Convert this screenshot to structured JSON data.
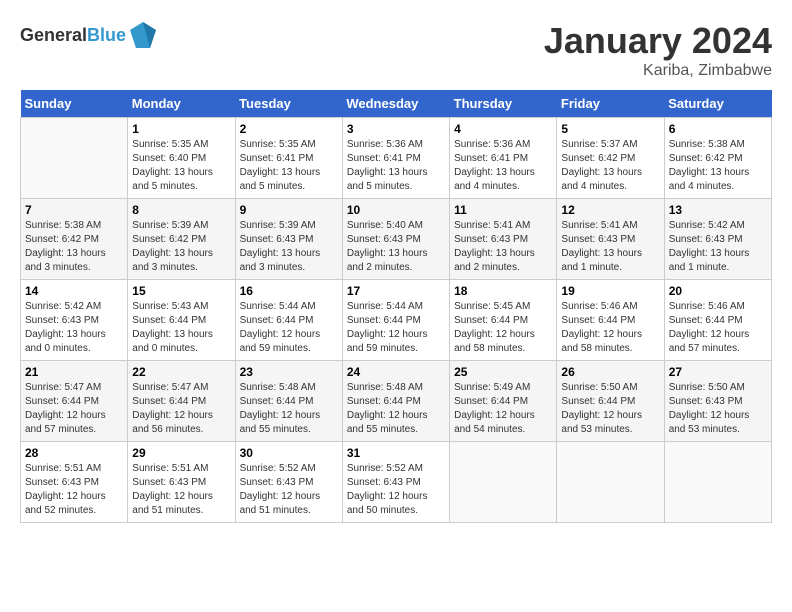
{
  "header": {
    "logo_general": "General",
    "logo_blue": "Blue",
    "month_year": "January 2024",
    "location": "Kariba, Zimbabwe"
  },
  "calendar": {
    "days_of_week": [
      "Sunday",
      "Monday",
      "Tuesday",
      "Wednesday",
      "Thursday",
      "Friday",
      "Saturday"
    ],
    "weeks": [
      [
        {
          "day": "",
          "sunrise": "",
          "sunset": "",
          "daylight": ""
        },
        {
          "day": "1",
          "sunrise": "Sunrise: 5:35 AM",
          "sunset": "Sunset: 6:40 PM",
          "daylight": "Daylight: 13 hours and 5 minutes."
        },
        {
          "day": "2",
          "sunrise": "Sunrise: 5:35 AM",
          "sunset": "Sunset: 6:41 PM",
          "daylight": "Daylight: 13 hours and 5 minutes."
        },
        {
          "day": "3",
          "sunrise": "Sunrise: 5:36 AM",
          "sunset": "Sunset: 6:41 PM",
          "daylight": "Daylight: 13 hours and 5 minutes."
        },
        {
          "day": "4",
          "sunrise": "Sunrise: 5:36 AM",
          "sunset": "Sunset: 6:41 PM",
          "daylight": "Daylight: 13 hours and 4 minutes."
        },
        {
          "day": "5",
          "sunrise": "Sunrise: 5:37 AM",
          "sunset": "Sunset: 6:42 PM",
          "daylight": "Daylight: 13 hours and 4 minutes."
        },
        {
          "day": "6",
          "sunrise": "Sunrise: 5:38 AM",
          "sunset": "Sunset: 6:42 PM",
          "daylight": "Daylight: 13 hours and 4 minutes."
        }
      ],
      [
        {
          "day": "7",
          "sunrise": "Sunrise: 5:38 AM",
          "sunset": "Sunset: 6:42 PM",
          "daylight": "Daylight: 13 hours and 3 minutes."
        },
        {
          "day": "8",
          "sunrise": "Sunrise: 5:39 AM",
          "sunset": "Sunset: 6:42 PM",
          "daylight": "Daylight: 13 hours and 3 minutes."
        },
        {
          "day": "9",
          "sunrise": "Sunrise: 5:39 AM",
          "sunset": "Sunset: 6:43 PM",
          "daylight": "Daylight: 13 hours and 3 minutes."
        },
        {
          "day": "10",
          "sunrise": "Sunrise: 5:40 AM",
          "sunset": "Sunset: 6:43 PM",
          "daylight": "Daylight: 13 hours and 2 minutes."
        },
        {
          "day": "11",
          "sunrise": "Sunrise: 5:41 AM",
          "sunset": "Sunset: 6:43 PM",
          "daylight": "Daylight: 13 hours and 2 minutes."
        },
        {
          "day": "12",
          "sunrise": "Sunrise: 5:41 AM",
          "sunset": "Sunset: 6:43 PM",
          "daylight": "Daylight: 13 hours and 1 minute."
        },
        {
          "day": "13",
          "sunrise": "Sunrise: 5:42 AM",
          "sunset": "Sunset: 6:43 PM",
          "daylight": "Daylight: 13 hours and 1 minute."
        }
      ],
      [
        {
          "day": "14",
          "sunrise": "Sunrise: 5:42 AM",
          "sunset": "Sunset: 6:43 PM",
          "daylight": "Daylight: 13 hours and 0 minutes."
        },
        {
          "day": "15",
          "sunrise": "Sunrise: 5:43 AM",
          "sunset": "Sunset: 6:44 PM",
          "daylight": "Daylight: 13 hours and 0 minutes."
        },
        {
          "day": "16",
          "sunrise": "Sunrise: 5:44 AM",
          "sunset": "Sunset: 6:44 PM",
          "daylight": "Daylight: 12 hours and 59 minutes."
        },
        {
          "day": "17",
          "sunrise": "Sunrise: 5:44 AM",
          "sunset": "Sunset: 6:44 PM",
          "daylight": "Daylight: 12 hours and 59 minutes."
        },
        {
          "day": "18",
          "sunrise": "Sunrise: 5:45 AM",
          "sunset": "Sunset: 6:44 PM",
          "daylight": "Daylight: 12 hours and 58 minutes."
        },
        {
          "day": "19",
          "sunrise": "Sunrise: 5:46 AM",
          "sunset": "Sunset: 6:44 PM",
          "daylight": "Daylight: 12 hours and 58 minutes."
        },
        {
          "day": "20",
          "sunrise": "Sunrise: 5:46 AM",
          "sunset": "Sunset: 6:44 PM",
          "daylight": "Daylight: 12 hours and 57 minutes."
        }
      ],
      [
        {
          "day": "21",
          "sunrise": "Sunrise: 5:47 AM",
          "sunset": "Sunset: 6:44 PM",
          "daylight": "Daylight: 12 hours and 57 minutes."
        },
        {
          "day": "22",
          "sunrise": "Sunrise: 5:47 AM",
          "sunset": "Sunset: 6:44 PM",
          "daylight": "Daylight: 12 hours and 56 minutes."
        },
        {
          "day": "23",
          "sunrise": "Sunrise: 5:48 AM",
          "sunset": "Sunset: 6:44 PM",
          "daylight": "Daylight: 12 hours and 55 minutes."
        },
        {
          "day": "24",
          "sunrise": "Sunrise: 5:48 AM",
          "sunset": "Sunset: 6:44 PM",
          "daylight": "Daylight: 12 hours and 55 minutes."
        },
        {
          "day": "25",
          "sunrise": "Sunrise: 5:49 AM",
          "sunset": "Sunset: 6:44 PM",
          "daylight": "Daylight: 12 hours and 54 minutes."
        },
        {
          "day": "26",
          "sunrise": "Sunrise: 5:50 AM",
          "sunset": "Sunset: 6:44 PM",
          "daylight": "Daylight: 12 hours and 53 minutes."
        },
        {
          "day": "27",
          "sunrise": "Sunrise: 5:50 AM",
          "sunset": "Sunset: 6:43 PM",
          "daylight": "Daylight: 12 hours and 53 minutes."
        }
      ],
      [
        {
          "day": "28",
          "sunrise": "Sunrise: 5:51 AM",
          "sunset": "Sunset: 6:43 PM",
          "daylight": "Daylight: 12 hours and 52 minutes."
        },
        {
          "day": "29",
          "sunrise": "Sunrise: 5:51 AM",
          "sunset": "Sunset: 6:43 PM",
          "daylight": "Daylight: 12 hours and 51 minutes."
        },
        {
          "day": "30",
          "sunrise": "Sunrise: 5:52 AM",
          "sunset": "Sunset: 6:43 PM",
          "daylight": "Daylight: 12 hours and 51 minutes."
        },
        {
          "day": "31",
          "sunrise": "Sunrise: 5:52 AM",
          "sunset": "Sunset: 6:43 PM",
          "daylight": "Daylight: 12 hours and 50 minutes."
        },
        {
          "day": "",
          "sunrise": "",
          "sunset": "",
          "daylight": ""
        },
        {
          "day": "",
          "sunrise": "",
          "sunset": "",
          "daylight": ""
        },
        {
          "day": "",
          "sunrise": "",
          "sunset": "",
          "daylight": ""
        }
      ]
    ]
  }
}
